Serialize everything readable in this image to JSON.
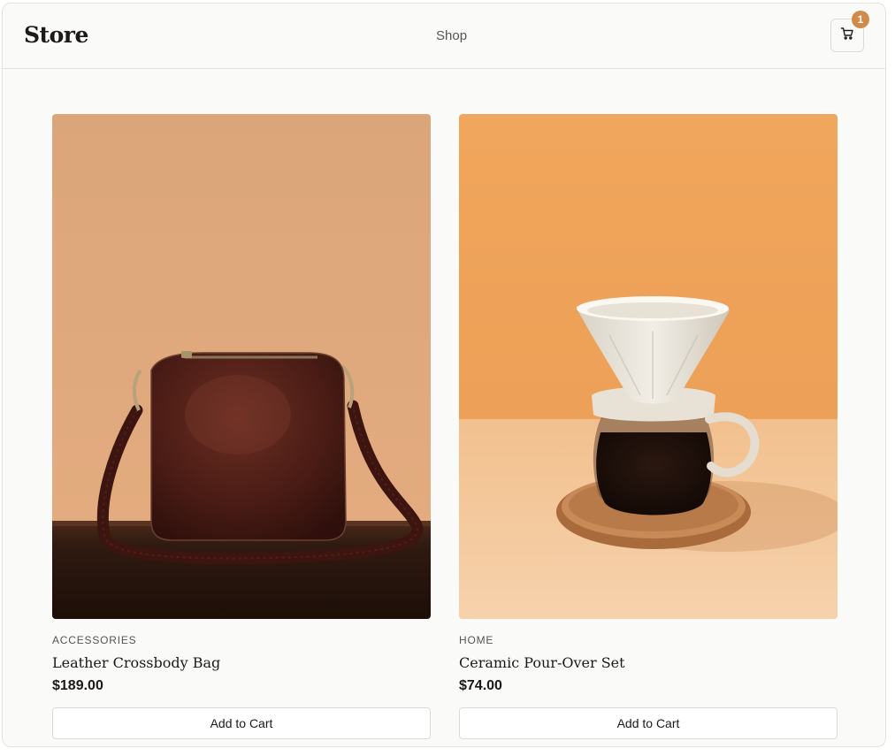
{
  "header": {
    "logo": "Store",
    "nav_shop": "Shop",
    "cart_count": "1",
    "cart_icon": "cart-icon"
  },
  "colors": {
    "accent": "#d08a4a",
    "background": "#fafaf8",
    "border": "#e4e2dd",
    "text": "#1c1917",
    "muted": "#57534e"
  },
  "products": [
    {
      "category": "ACCESSORIES",
      "name": "Leather Crossbody Bag",
      "price": "$189.00",
      "button": "Add to Cart",
      "image": "leather-bag-photo"
    },
    {
      "category": "HOME",
      "name": "Ceramic Pour-Over Set",
      "price": "$74.00",
      "button": "Add to Cart",
      "image": "pour-over-photo"
    }
  ]
}
